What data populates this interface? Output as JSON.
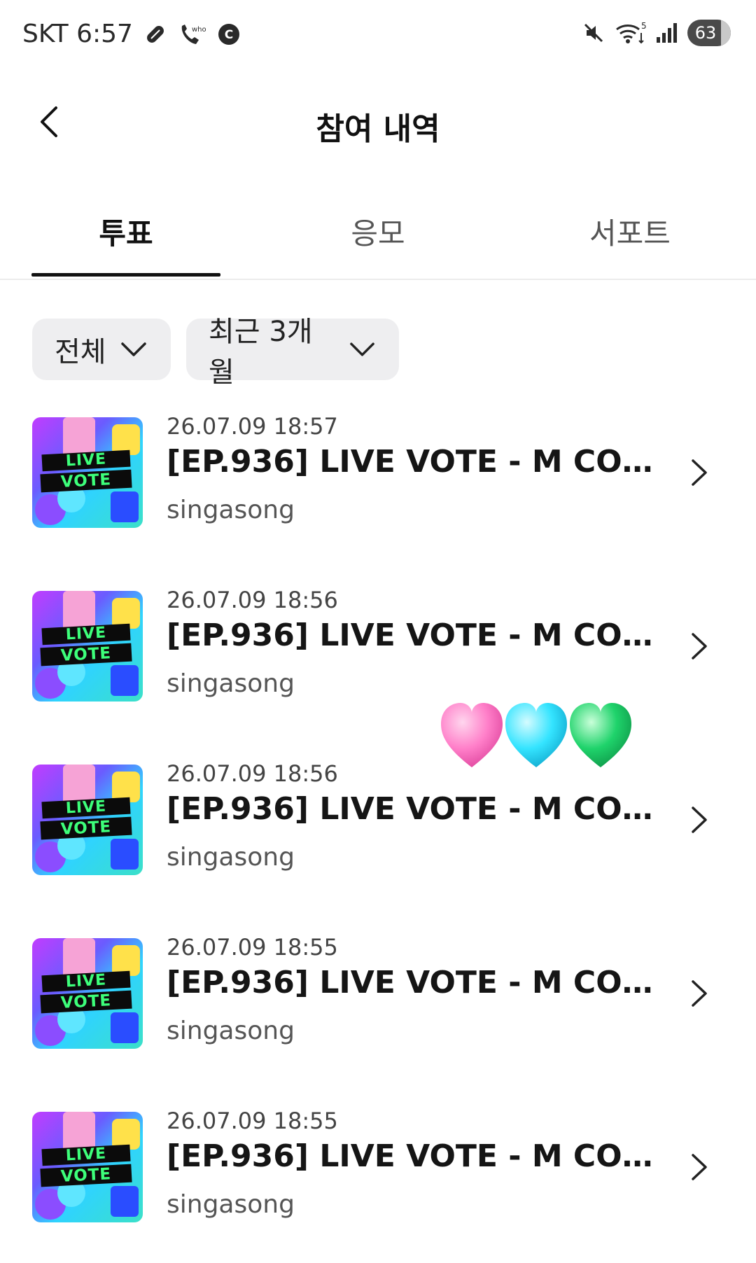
{
  "status_bar": {
    "carrier_time": "SKT 6:57",
    "left_icons": [
      "pill-icon",
      "phone-who-icon",
      "c-badge-icon"
    ],
    "right_icons": [
      "mute-icon",
      "wifi-icon",
      "signal-icon"
    ],
    "network_badge": "5",
    "battery": "63"
  },
  "header": {
    "title": "참여 내역",
    "back_icon": "chevron-left-icon"
  },
  "tabs": [
    {
      "label": "투표",
      "active": true
    },
    {
      "label": "응모",
      "active": false
    },
    {
      "label": "서포트",
      "active": false
    }
  ],
  "filters": [
    {
      "label": "전체",
      "icon": "chevron-down-icon"
    },
    {
      "label": "최근 3개월",
      "icon": "chevron-down-icon"
    }
  ],
  "items": [
    {
      "date": "26.07.09 18:57",
      "title": "[EP.936] LIVE VOTE - M COUN...",
      "subtitle": "singasong",
      "thumb_line1": "LIVE",
      "thumb_line2": "VOTE"
    },
    {
      "date": "26.07.09 18:56",
      "title": "[EP.936] LIVE VOTE - M COUN...",
      "subtitle": "singasong",
      "thumb_line1": "LIVE",
      "thumb_line2": "VOTE"
    },
    {
      "date": "26.07.09 18:56",
      "title": "[EP.936] LIVE VOTE - M COUN...",
      "subtitle": "singasong",
      "thumb_line1": "LIVE",
      "thumb_line2": "VOTE"
    },
    {
      "date": "26.07.09 18:55",
      "title": "[EP.936] LIVE VOTE - M COUN...",
      "subtitle": "singasong",
      "thumb_line1": "LIVE",
      "thumb_line2": "VOTE"
    },
    {
      "date": "26.07.09 18:55",
      "title": "[EP.936] LIVE VOTE - M COUN...",
      "subtitle": "singasong",
      "thumb_line1": "LIVE",
      "thumb_line2": "VOTE"
    }
  ],
  "sticker": {
    "icons": [
      "pink-heart-icon",
      "cyan-heart-icon",
      "green-heart-icon"
    ],
    "colors": [
      "#ff7fc9",
      "#34e4ff",
      "#1fd36b"
    ]
  }
}
